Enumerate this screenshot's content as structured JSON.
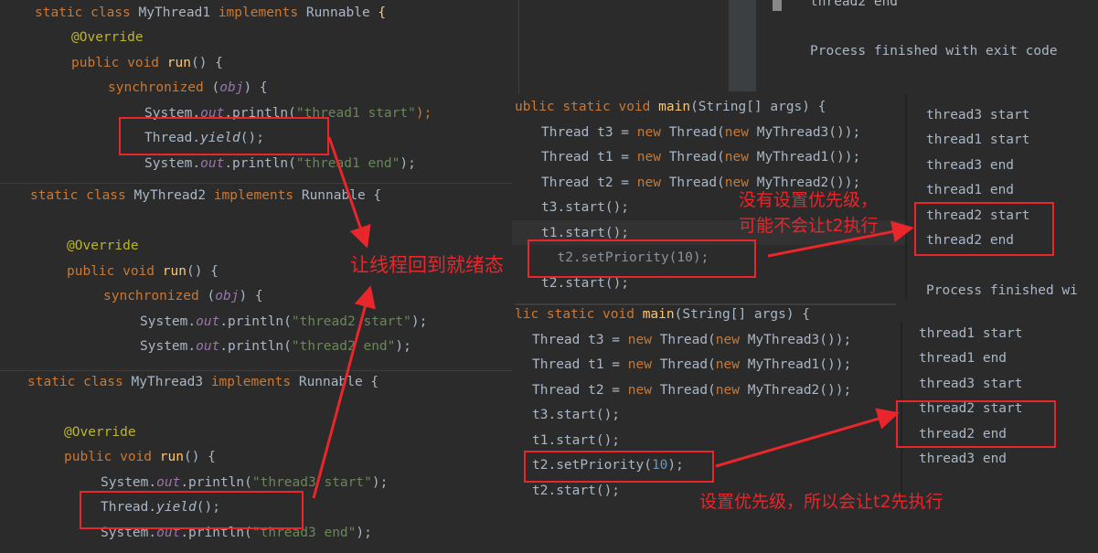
{
  "panels": {
    "thread1": [
      [
        [
          "static class ",
          "k"
        ],
        [
          "MyThread1 ",
          ""
        ],
        [
          "implements ",
          "k"
        ],
        [
          "Runnable ",
          ""
        ],
        [
          "{",
          "m"
        ]
      ],
      [
        [
          "@Override",
          "a"
        ]
      ],
      [
        [
          "public void ",
          "k"
        ],
        [
          "run",
          "m"
        ],
        [
          "() {",
          ""
        ]
      ],
      [
        [
          "synchronized ",
          "k"
        ],
        [
          "(",
          ""
        ],
        [
          "obj",
          "f"
        ],
        [
          ") {",
          ""
        ]
      ],
      [
        [
          "System.",
          ""
        ],
        [
          "out",
          "f"
        ],
        [
          ".println(",
          ""
        ],
        [
          "\"thread1 start\"",
          "s"
        ],
        [
          ");",
          "k"
        ]
      ],
      [
        [
          "Thread.",
          ""
        ],
        [
          "yield",
          "i"
        ],
        [
          "();",
          ""
        ]
      ],
      [
        [
          "System.",
          ""
        ],
        [
          "out",
          "f"
        ],
        [
          ".println(",
          ""
        ],
        [
          "\"thread1 end\"",
          "s"
        ],
        [
          ");",
          ""
        ]
      ]
    ],
    "thread2": [
      [
        [
          "static class ",
          "k"
        ],
        [
          "MyThread2 ",
          ""
        ],
        [
          "implements ",
          "k"
        ],
        [
          "Runnable {",
          ""
        ]
      ],
      [
        [
          "",
          ""
        ]
      ],
      [
        [
          "@Override",
          "a"
        ]
      ],
      [
        [
          "public void ",
          "k"
        ],
        [
          "run",
          "m"
        ],
        [
          "() {",
          ""
        ]
      ],
      [
        [
          "synchronized ",
          "k"
        ],
        [
          "(",
          ""
        ],
        [
          "obj",
          "f"
        ],
        [
          ") {",
          ""
        ]
      ],
      [
        [
          "System.",
          ""
        ],
        [
          "out",
          "f"
        ],
        [
          ".println(",
          ""
        ],
        [
          "\"thread2 start\"",
          "s"
        ],
        [
          ");",
          ""
        ]
      ],
      [
        [
          "System.",
          ""
        ],
        [
          "out",
          "f"
        ],
        [
          ".println(",
          ""
        ],
        [
          "\"thread2 end\"",
          "s"
        ],
        [
          ");",
          ""
        ]
      ]
    ],
    "thread3": [
      [
        [
          "static class ",
          "k"
        ],
        [
          "MyThread3 ",
          ""
        ],
        [
          "implements ",
          "k"
        ],
        [
          "Runnable {",
          ""
        ]
      ],
      [
        [
          "",
          ""
        ]
      ],
      [
        [
          "@Override",
          "a"
        ]
      ],
      [
        [
          "public void ",
          "k"
        ],
        [
          "run",
          "m"
        ],
        [
          "() {",
          ""
        ]
      ],
      [
        [
          "System.",
          ""
        ],
        [
          "out",
          "f"
        ],
        [
          ".println(",
          ""
        ],
        [
          "\"thread3 start\"",
          "s"
        ],
        [
          ");",
          ""
        ]
      ],
      [
        [
          "Thread.",
          ""
        ],
        [
          "yield",
          "i"
        ],
        [
          "();",
          ""
        ]
      ],
      [
        [
          "System.",
          ""
        ],
        [
          "out",
          "f"
        ],
        [
          ".println(",
          ""
        ],
        [
          "\"thread3 end\"",
          "s"
        ],
        [
          ");",
          ""
        ]
      ]
    ],
    "main1": [
      [
        [
          "ublic static void ",
          "k"
        ],
        [
          "main",
          "m"
        ],
        [
          "(String[] args) {",
          ""
        ]
      ],
      [
        [
          "Thread t3 = ",
          ""
        ],
        [
          "new ",
          "k"
        ],
        [
          "Thread(",
          ""
        ],
        [
          "new ",
          "k"
        ],
        [
          "MyThread3());",
          ""
        ]
      ],
      [
        [
          "Thread t1 = ",
          ""
        ],
        [
          "new ",
          "k"
        ],
        [
          "Thread(",
          ""
        ],
        [
          "new ",
          "k"
        ],
        [
          "MyThread1());",
          ""
        ]
      ],
      [
        [
          "Thread t2 = ",
          ""
        ],
        [
          "new ",
          "k"
        ],
        [
          "Thread(",
          ""
        ],
        [
          "new ",
          "k"
        ],
        [
          "MyThread2());",
          ""
        ]
      ],
      [
        [
          "t3.start();",
          ""
        ]
      ],
      [
        [
          "t1.start();",
          ""
        ]
      ],
      [
        [
          "  t2.setPriority(10);",
          "dim"
        ]
      ],
      [
        [
          "t2.start();",
          ""
        ]
      ]
    ],
    "main2": [
      [
        [
          "lic static void ",
          "k"
        ],
        [
          "main",
          "m"
        ],
        [
          "(String[] args) {",
          ""
        ]
      ],
      [
        [
          "Thread t3 = ",
          ""
        ],
        [
          "new ",
          "k"
        ],
        [
          "Thread(",
          ""
        ],
        [
          "new ",
          "k"
        ],
        [
          "MyThread3());",
          ""
        ]
      ],
      [
        [
          "Thread t1 = ",
          ""
        ],
        [
          "new ",
          "k"
        ],
        [
          "Thread(",
          ""
        ],
        [
          "new ",
          "k"
        ],
        [
          "MyThread1());",
          ""
        ]
      ],
      [
        [
          "Thread t2 = ",
          ""
        ],
        [
          "new ",
          "k"
        ],
        [
          "Thread(",
          ""
        ],
        [
          "new ",
          "k"
        ],
        [
          "MyThread2());",
          ""
        ]
      ],
      [
        [
          "t3.start();",
          ""
        ]
      ],
      [
        [
          "t1.start();",
          ""
        ]
      ],
      [
        [
          "t2.setPriority(",
          ""
        ],
        [
          "10",
          "n"
        ],
        [
          ");",
          ""
        ]
      ],
      [
        [
          "t2.start();",
          ""
        ]
      ]
    ]
  },
  "console_top": [
    "thread2 end",
    "",
    "Process finished with exit code"
  ],
  "console1": [
    "thread3 start",
    "thread1 start",
    "thread3 end",
    "thread1 end",
    "thread2 start",
    "thread2 end",
    "",
    "Process finished wi"
  ],
  "console2": [
    "thread1 start",
    "thread1 end",
    "thread3 start",
    "thread2 start",
    "thread2 end",
    "thread3 end"
  ],
  "annotations": {
    "yield_note": "让线程回到就绪态",
    "no_priority_note_1": "没有设置优先级，",
    "no_priority_note_2": "可能不会让t2执行",
    "priority_note": "设置优先级，所以会让t2先执行"
  },
  "colors": {
    "annotation": "#e8262b",
    "background": "#2b2b2b"
  }
}
